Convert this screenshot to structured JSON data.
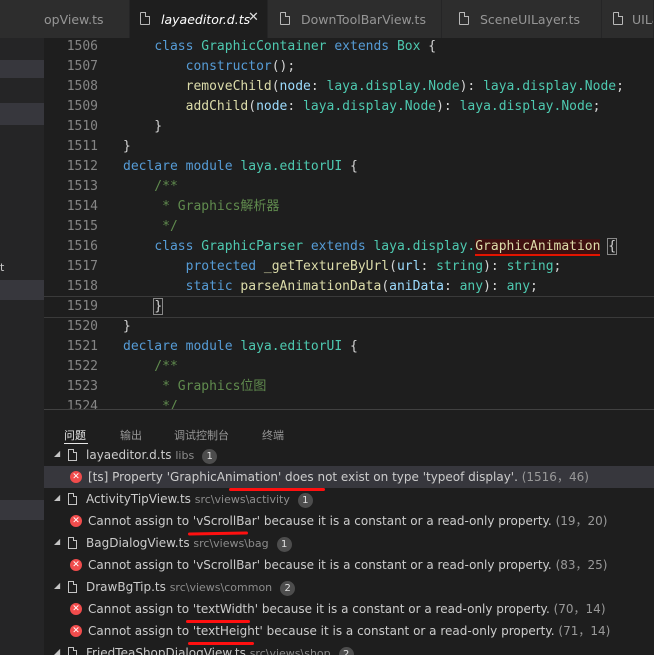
{
  "tabs": [
    {
      "label": "opView.ts",
      "active": false
    },
    {
      "label": "layaeditor.d.ts",
      "active": true
    },
    {
      "label": "DownToolBarView.ts",
      "active": false
    },
    {
      "label": "SceneUILayer.ts",
      "active": false
    },
    {
      "label": "UILa",
      "active": false
    }
  ],
  "sidebar": {
    "stray_text": "t"
  },
  "editor": {
    "first_line": 1506,
    "lines": [
      [
        [
          "    ",
          "pu"
        ],
        [
          "class ",
          "kw"
        ],
        [
          "GraphicContainer ",
          "ty"
        ],
        [
          "extends ",
          "kw"
        ],
        [
          "Box ",
          "ty"
        ],
        [
          "{",
          "pu"
        ]
      ],
      [
        [
          "        ",
          "pu"
        ],
        [
          "constructor",
          "kw"
        ],
        [
          "();",
          "pu"
        ]
      ],
      [
        [
          "        ",
          "pu"
        ],
        [
          "removeChild",
          "fn"
        ],
        [
          "(",
          "pu"
        ],
        [
          "node",
          "pr"
        ],
        [
          ": ",
          "pu"
        ],
        [
          "laya.display.Node",
          "ty"
        ],
        [
          "): ",
          "pu"
        ],
        [
          "laya.display.Node",
          "ty"
        ],
        [
          ";",
          "pu"
        ]
      ],
      [
        [
          "        ",
          "pu"
        ],
        [
          "addChild",
          "fn"
        ],
        [
          "(",
          "pu"
        ],
        [
          "node",
          "pr"
        ],
        [
          ": ",
          "pu"
        ],
        [
          "laya.display.Node",
          "ty"
        ],
        [
          "): ",
          "pu"
        ],
        [
          "laya.display.Node",
          "ty"
        ],
        [
          ";",
          "pu"
        ]
      ],
      [
        [
          "    }",
          "pu"
        ]
      ],
      [
        [
          "}",
          "pu"
        ]
      ],
      [
        [
          "declare ",
          "kw"
        ],
        [
          "module ",
          "kw"
        ],
        [
          "laya.editorUI ",
          "ty"
        ],
        [
          "{",
          "pu"
        ]
      ],
      [
        [
          "    /**",
          "cm"
        ]
      ],
      [
        [
          "     * Graphics解析器",
          "cm"
        ]
      ],
      [
        [
          "     */",
          "cm"
        ]
      ],
      [
        [
          "    ",
          "pu"
        ],
        [
          "class ",
          "kw"
        ],
        [
          "GraphicParser ",
          "ty"
        ],
        [
          "extends ",
          "kw"
        ],
        [
          "laya.display.",
          "ty"
        ],
        [
          "GraphicAnimation",
          "fn",
          "err"
        ],
        [
          " ",
          "pu"
        ],
        [
          "{",
          "pu",
          "ob"
        ]
      ],
      [
        [
          "        ",
          "pu"
        ],
        [
          "protected ",
          "kw"
        ],
        [
          "_getTextureByUrl",
          "fn"
        ],
        [
          "(",
          "pu"
        ],
        [
          "url",
          "pr"
        ],
        [
          ": ",
          "pu"
        ],
        [
          "string",
          "ty"
        ],
        [
          "): ",
          "pu"
        ],
        [
          "string",
          "ty"
        ],
        [
          ";",
          "pu"
        ]
      ],
      [
        [
          "        ",
          "pu"
        ],
        [
          "static ",
          "kw"
        ],
        [
          "parseAnimationData",
          "fn"
        ],
        [
          "(",
          "pu"
        ],
        [
          "aniData",
          "pr"
        ],
        [
          ": ",
          "pu"
        ],
        [
          "any",
          "ty"
        ],
        [
          "): ",
          "pu"
        ],
        [
          "any",
          "ty"
        ],
        [
          ";",
          "pu"
        ]
      ],
      [
        [
          "    ",
          "pu"
        ],
        [
          "}",
          "pu",
          "ob"
        ]
      ],
      [
        [
          "}",
          "pu"
        ]
      ],
      [
        [
          "declare ",
          "kw"
        ],
        [
          "module ",
          "kw"
        ],
        [
          "laya.editorUI ",
          "ty"
        ],
        [
          "{",
          "pu"
        ]
      ],
      [
        [
          "    /**",
          "cm"
        ]
      ],
      [
        [
          "     * Graphics位图",
          "cm"
        ]
      ],
      [
        [
          "     */",
          "cm"
        ]
      ]
    ]
  },
  "panel": {
    "tabs": [
      "问题",
      "输出",
      "调试控制台",
      "终端"
    ],
    "rows": [
      {
        "kind": "file",
        "name": "layaeditor.d.ts",
        "path": "libs",
        "count": "1"
      },
      {
        "kind": "error",
        "message": "[ts] Property 'GraphicAnimation' does not exist on type 'typeof display'.",
        "loc": "(1516，46)",
        "selected": true
      },
      {
        "kind": "file",
        "name": "ActivityTipView.ts",
        "path": "src\\views\\activity",
        "count": "1"
      },
      {
        "kind": "error",
        "message": "Cannot assign to 'vScrollBar' because it is a constant or a read-only property.",
        "loc": "(19，20)"
      },
      {
        "kind": "file",
        "name": "BagDialogView.ts",
        "path": "src\\views\\bag",
        "count": "1"
      },
      {
        "kind": "error",
        "message": "Cannot assign to 'vScrollBar' because it is a constant or a read-only property.",
        "loc": "(83，25)"
      },
      {
        "kind": "file",
        "name": "DrawBgTip.ts",
        "path": "src\\views\\common",
        "count": "2"
      },
      {
        "kind": "error",
        "message": "Cannot assign to 'textWidth' because it is a constant or a read-only property.",
        "loc": "(70，14)"
      },
      {
        "kind": "error",
        "message": "Cannot assign to 'textHeight' because it is a constant or a read-only property.",
        "loc": "(71，14)"
      },
      {
        "kind": "file",
        "name": "FriedTeaShopDialogView.ts",
        "path": "src\\views\\shop",
        "count": "2"
      }
    ]
  },
  "colors": {
    "error": "#f14c4c",
    "annotation_red": "#ff1010",
    "keyword": "#569cd6",
    "type": "#4ec9b0"
  }
}
